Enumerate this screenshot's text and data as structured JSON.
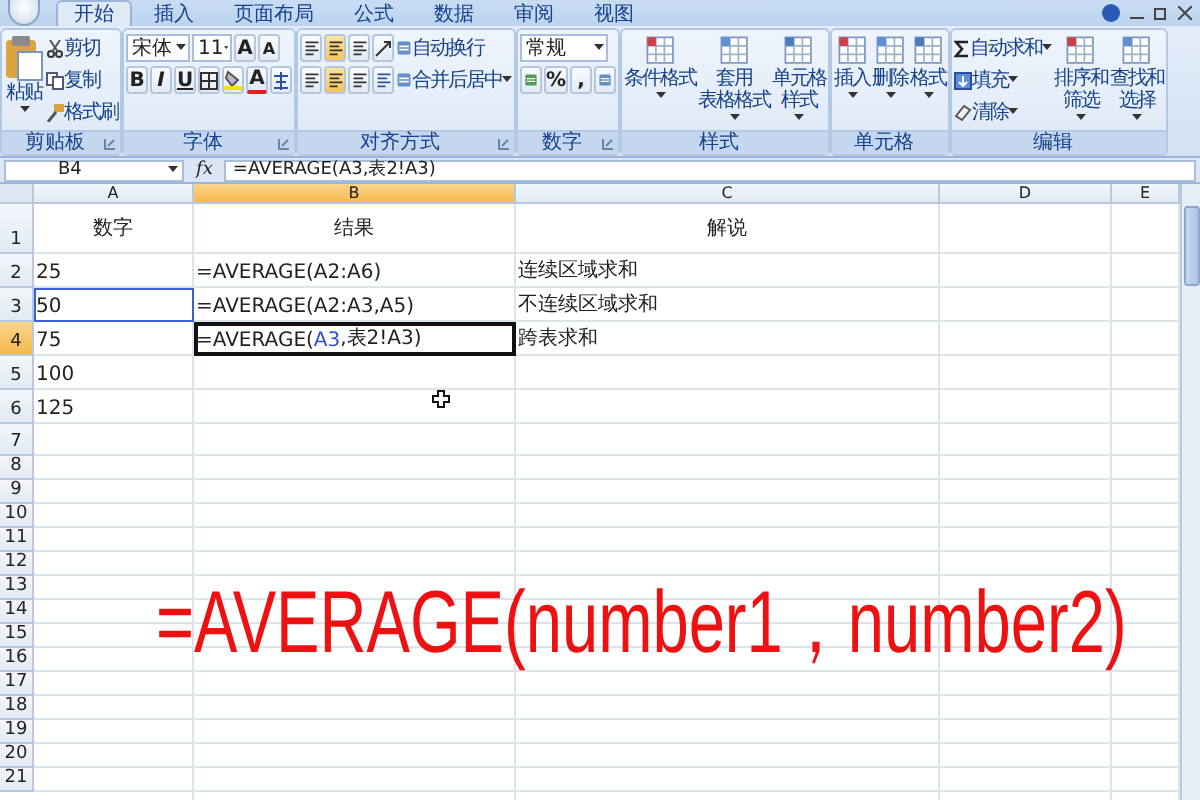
{
  "tabs": [
    {
      "label": "开始",
      "selected": true
    },
    {
      "label": "插入",
      "selected": false
    },
    {
      "label": "页面布局",
      "selected": false
    },
    {
      "label": "公式",
      "selected": false
    },
    {
      "label": "数据",
      "selected": false
    },
    {
      "label": "审阅",
      "selected": false
    },
    {
      "label": "视图",
      "selected": false
    }
  ],
  "ribbon": {
    "groups": [
      {
        "kind": "clipboard",
        "label": "剪贴板",
        "paste": "粘贴",
        "actions": [
          "剪切",
          "复制",
          "格式刷"
        ]
      },
      {
        "kind": "font",
        "label": "字体",
        "font_name": "宋体",
        "font_size": "11",
        "grow_shrink": [
          "A",
          "A"
        ],
        "styles": [
          "B",
          "I",
          "U"
        ],
        "font_color": "A"
      },
      {
        "kind": "alignment",
        "label": "对齐方式",
        "wrap": "自动换行",
        "merge": "合并后居中"
      },
      {
        "kind": "number",
        "label": "数字",
        "format": "常规",
        "symbols": [
          "%",
          ","
        ]
      },
      {
        "kind": "large",
        "label": "样式",
        "items": [
          {
            "lines": [
              "条件格式"
            ]
          },
          {
            "lines": [
              "套用",
              "表格格式"
            ]
          },
          {
            "lines": [
              "单元格",
              "样式"
            ]
          }
        ]
      },
      {
        "kind": "large",
        "label": "单元格",
        "items": [
          {
            "lines": [
              "插入"
            ]
          },
          {
            "lines": [
              "删除"
            ]
          },
          {
            "lines": [
              "格式"
            ]
          }
        ]
      },
      {
        "kind": "editing",
        "label": "编辑",
        "actions": [
          "自动求和",
          "填充",
          "清除"
        ],
        "items": [
          {
            "lines": [
              "排序和",
              "筛选"
            ]
          },
          {
            "lines": [
              "查找和",
              "选择"
            ]
          }
        ]
      }
    ]
  },
  "formula_bar": {
    "name_box": "B4",
    "fx": "fx",
    "formula": "=AVERAGE(A3,表2!A3)"
  },
  "sheet": {
    "columns": [
      {
        "label": "A",
        "selected": false
      },
      {
        "label": "B",
        "selected": true
      },
      {
        "label": "C",
        "selected": false
      },
      {
        "label": "D",
        "selected": false
      },
      {
        "label": "E",
        "selected": false
      }
    ],
    "rows": [
      {
        "number": "1",
        "selected": false,
        "cells": [
          {
            "text": "数字"
          },
          {
            "text": "结果"
          },
          {
            "text": "解说"
          }
        ]
      },
      {
        "number": "2",
        "selected": false,
        "cells": [
          {
            "text": "25"
          },
          {
            "text": "=AVERAGE(A2:A6)"
          },
          {
            "text": "连续区域求和"
          }
        ]
      },
      {
        "number": "3",
        "selected": false,
        "cells": [
          {
            "text": "50",
            "highlighted": true
          },
          {
            "text": "=AVERAGE(A2:A3,A5)"
          },
          {
            "text": "不连续区域求和"
          }
        ]
      },
      {
        "number": "4",
        "selected": true,
        "cells": [
          {
            "text": "75"
          },
          {
            "active": true,
            "parts": [
              {
                "kind": "text",
                "text": "=AVERAGE("
              },
              {
                "kind": "ref",
                "text": "A3"
              },
              {
                "kind": "text",
                "text": ",表2!A3)"
              }
            ]
          },
          {
            "text": "跨表求和"
          }
        ]
      },
      {
        "number": "5",
        "selected": false,
        "cells": [
          {
            "text": "100"
          }
        ]
      },
      {
        "number": "6",
        "selected": false,
        "cells": [
          {
            "text": "125"
          }
        ]
      },
      {
        "number": "7",
        "selected": false
      },
      {
        "number": "8",
        "selected": false
      },
      {
        "number": "9",
        "selected": false
      },
      {
        "number": "10",
        "selected": false
      },
      {
        "number": "11",
        "selected": false
      },
      {
        "number": "12",
        "selected": false
      },
      {
        "number": "13",
        "selected": false
      },
      {
        "number": "14",
        "selected": false
      },
      {
        "number": "15",
        "selected": false
      },
      {
        "number": "16",
        "selected": false
      },
      {
        "number": "17",
        "selected": false
      },
      {
        "number": "18",
        "selected": false
      },
      {
        "number": "19",
        "selected": false
      },
      {
        "number": "20",
        "selected": false
      },
      {
        "number": "21",
        "selected": false
      }
    ]
  },
  "caption": "=AVERAGE(number1，number2)"
}
